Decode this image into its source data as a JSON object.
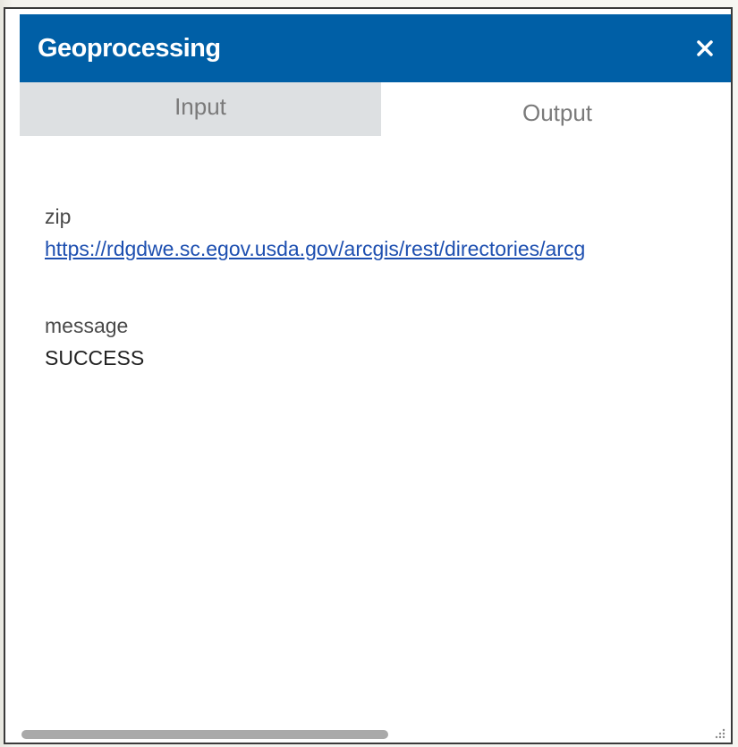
{
  "window": {
    "title": "Geoprocessing",
    "close_icon": "close-icon",
    "header_color": "#005fa6"
  },
  "tabs": [
    {
      "label": "Input",
      "active": false
    },
    {
      "label": "Output",
      "active": true
    }
  ],
  "output": {
    "fields": [
      {
        "label": "zip",
        "value": "https://rdgdwe.sc.egov.usda.gov/arcgis/rest/directories/arcg",
        "type": "link"
      },
      {
        "label": "message",
        "value": "SUCCESS",
        "type": "text"
      }
    ]
  },
  "colors": {
    "link": "#1d4fb0",
    "inactive_tab_bg": "#dde0e2",
    "scrollbar_thumb": "#a9a9a9"
  }
}
